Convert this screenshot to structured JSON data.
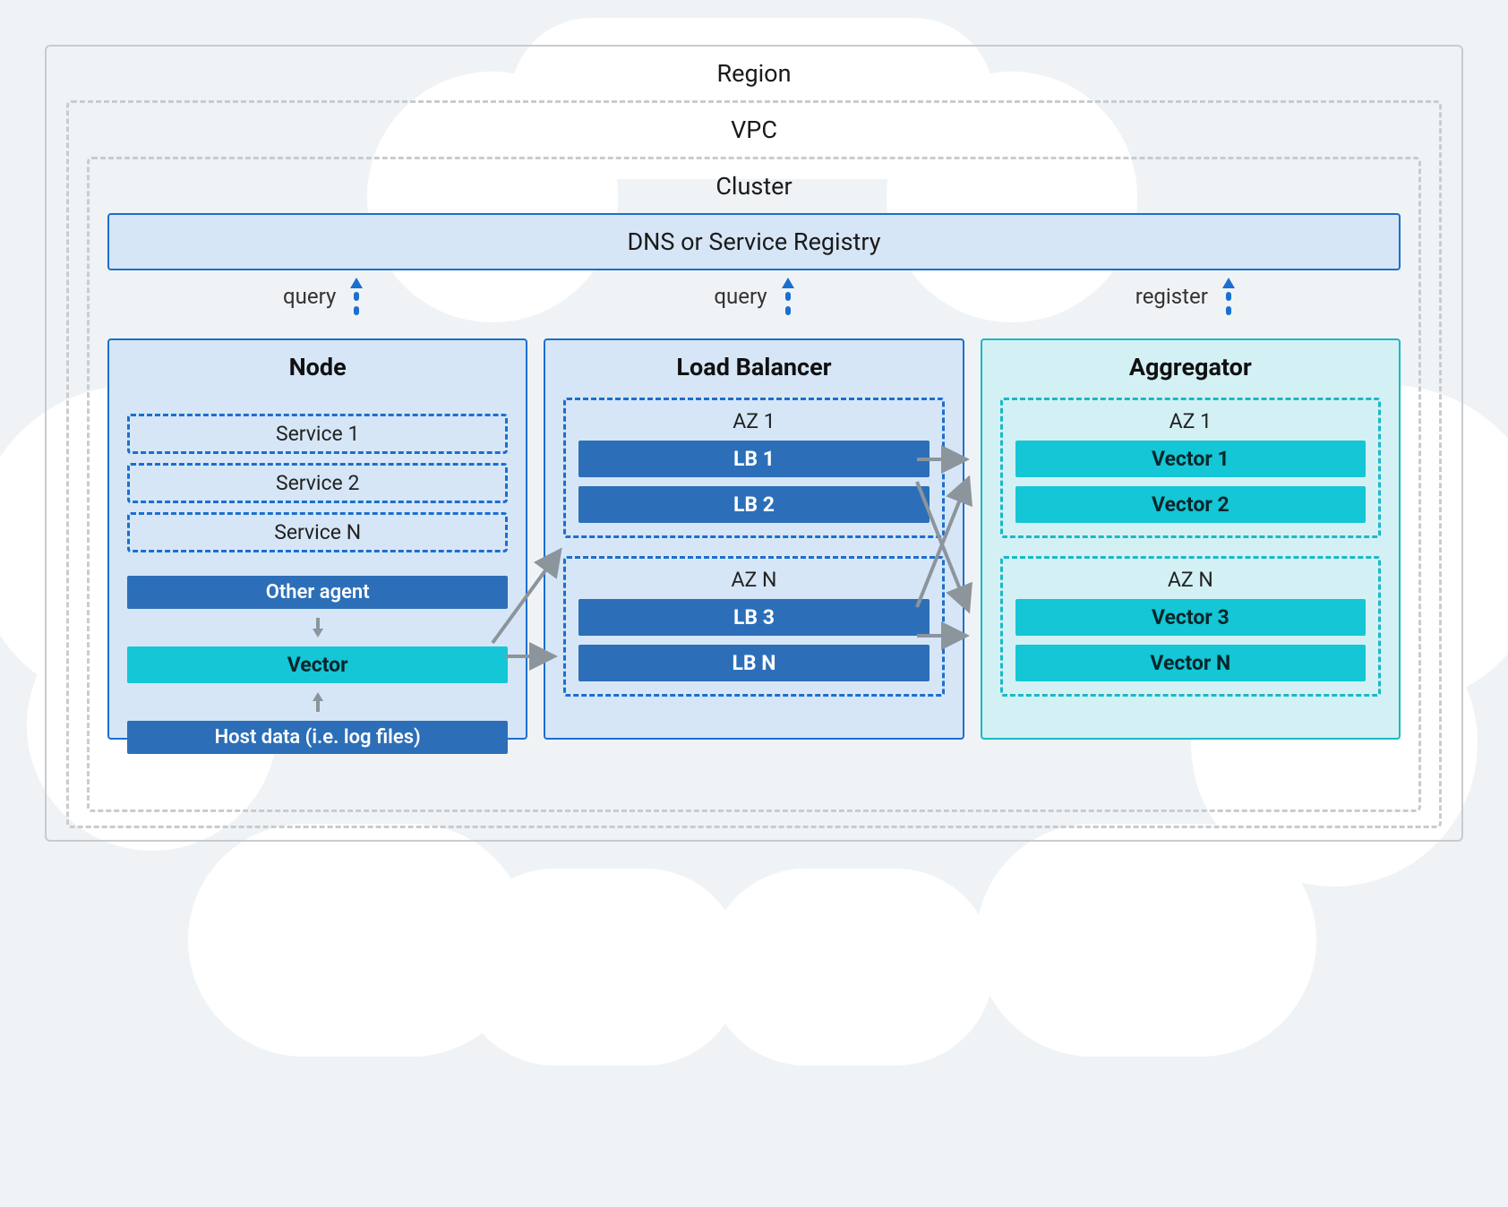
{
  "region": {
    "title": "Region"
  },
  "vpc": {
    "title": "VPC"
  },
  "cluster": {
    "title": "Cluster",
    "dns": "DNS or Service Registry",
    "arrows": {
      "query_left": "query",
      "query_mid": "query",
      "register": "register"
    }
  },
  "node": {
    "title": "Node",
    "services": [
      "Service 1",
      "Service 2",
      "Service N"
    ],
    "other_agent": "Other agent",
    "vector": "Vector",
    "host_data": "Host data (i.e. log files)"
  },
  "lb": {
    "title": "Load Balancer",
    "azs": [
      {
        "name": "AZ 1",
        "items": [
          "LB 1",
          "LB 2"
        ]
      },
      {
        "name": "AZ N",
        "items": [
          "LB 3",
          "LB N"
        ]
      }
    ]
  },
  "agg": {
    "title": "Aggregator",
    "azs": [
      {
        "name": "AZ 1",
        "items": [
          "Vector 1",
          "Vector 2"
        ]
      },
      {
        "name": "AZ N",
        "items": [
          "Vector 3",
          "Vector N"
        ]
      }
    ]
  }
}
